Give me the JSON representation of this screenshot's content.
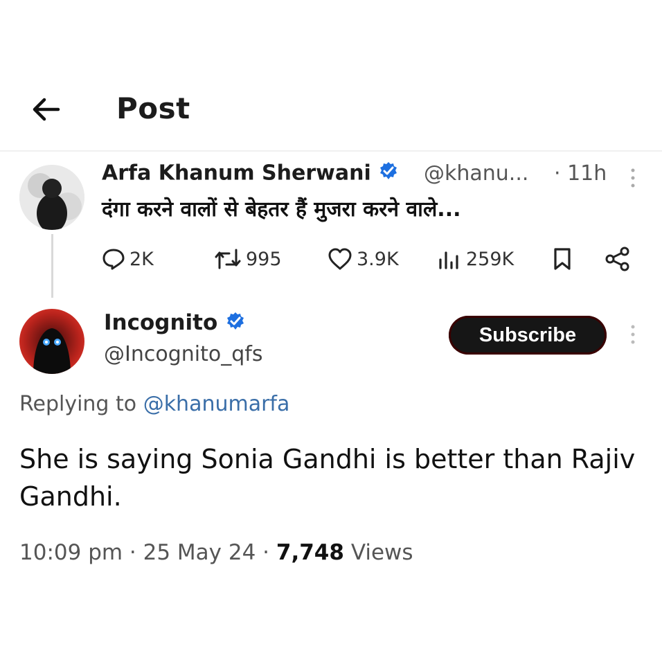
{
  "header": {
    "title": "Post"
  },
  "parent_post": {
    "author_name": "Arfa Khanum Sherwani",
    "handle": "@khanu...",
    "time": "· 11h",
    "text": "दंगा करने वालों से बेहतर हैं मुजरा करने वाले...",
    "actions": {
      "replies": "2K",
      "reposts": "995",
      "likes": "3.9K",
      "views": "259K"
    }
  },
  "reply_post": {
    "author_name": "Incognito",
    "handle": "@Incognito_qfs",
    "subscribe_label": "Subscribe",
    "replying_prefix": "Replying to",
    "replying_to": "@khanumarfa",
    "text": "She is saying Sonia Gandhi is better than Rajiv Gandhi.",
    "time": "10:09 pm · 25 May 24 ·",
    "views_count": "7,748",
    "views_label": "Views"
  },
  "colors": {
    "verified": "#1d6fe0",
    "subscribe_bg": "#161616",
    "accent_red": "#b21e1e"
  }
}
